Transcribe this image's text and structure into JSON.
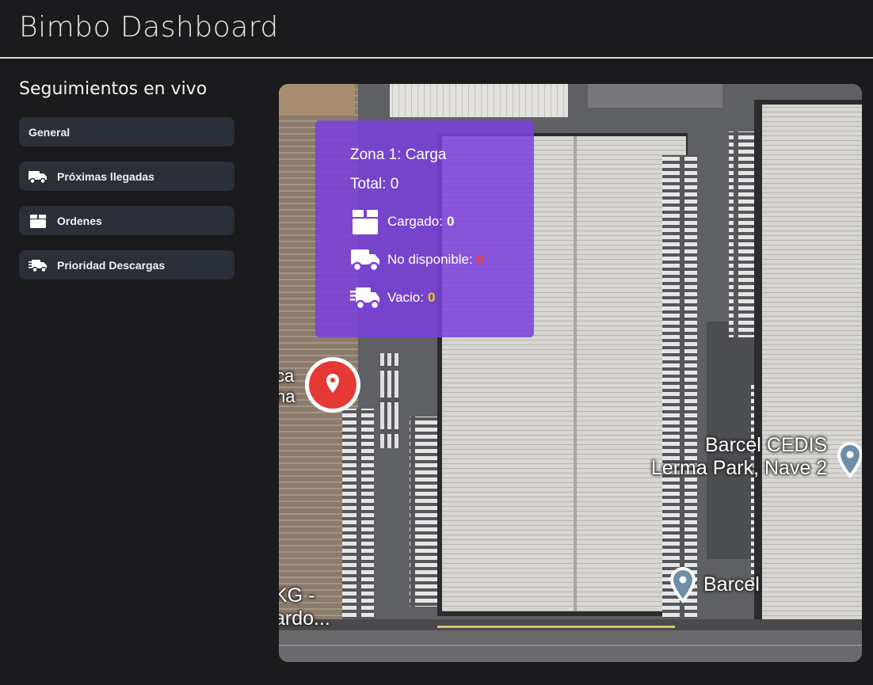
{
  "app": {
    "title": "Bimbo Dashboard"
  },
  "sidebar": {
    "heading": "Seguimientos en vivo",
    "items": [
      {
        "label": "General",
        "icon": "none"
      },
      {
        "label": "Próximas llegadas",
        "icon": "truck-icon"
      },
      {
        "label": "Ordenes",
        "icon": "box-icon"
      },
      {
        "label": "Prioridad Descargas",
        "icon": "fast-truck-icon"
      }
    ]
  },
  "map": {
    "zone": {
      "title": "Zona 1: Carga",
      "total_label": "Total: 0",
      "rows": [
        {
          "label": "Cargado:",
          "value": "0",
          "color": "#ffffff",
          "icon": "box-icon"
        },
        {
          "label": "No disponible:",
          "value": "0",
          "color": "#ff3b3b",
          "icon": "truck-icon"
        },
        {
          "label": "Vacio:",
          "value": "0",
          "color": "#f5c518",
          "icon": "fast-truck-icon"
        }
      ]
    },
    "labels": {
      "cedis_line1": "Barcel CEDIS",
      "cedis_line2": "Lerma Park, Nave 2",
      "barcel": "Barcel",
      "left_partial_1": "ca",
      "left_partial_2": "na",
      "bottom_partial_1": "KG -",
      "bottom_partial_2": "ardo..."
    },
    "colors": {
      "accent_pin": "#e53935",
      "zone_card": "#7a40dc"
    }
  }
}
